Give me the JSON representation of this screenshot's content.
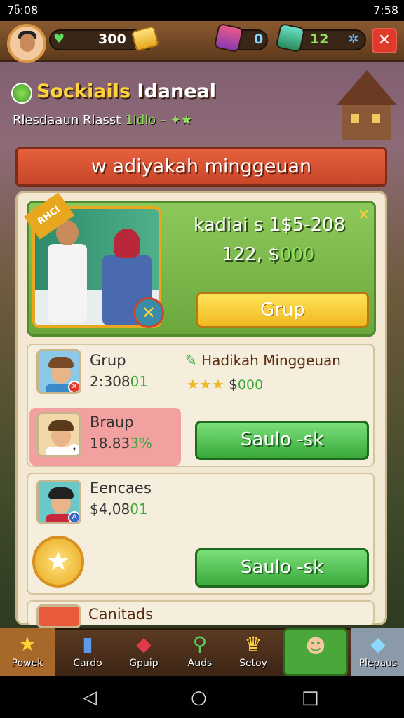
{
  "status_bar": {
    "time_left": "7ნ:08",
    "time_right": "7:58"
  },
  "top_bar": {
    "coins": "300",
    "gem_a": "0",
    "gem_b": "12",
    "close_label": "✕"
  },
  "header": {
    "title_yellow": "Sockiails",
    "title_white": "Idaneal",
    "subtitle": "Rlesdaaun Rlasst",
    "subtitle_green": "1Idlo",
    "subtitle_tail": "– ✦★"
  },
  "banner": {
    "label": "w adiyakah minggeuan"
  },
  "feature": {
    "corner_tag": "RHCI",
    "line1": "kadiai s 1$5-208",
    "line2_prefix": "122, $",
    "line2_green": "000",
    "button_label": "Grup",
    "close_label": "✕"
  },
  "rows": [
    {
      "name": "Grup",
      "value_prefix": "2:308",
      "value_green": "01"
    },
    {
      "name": "Braup",
      "value_prefix": "18.83",
      "value_green": "3%"
    },
    {
      "name": "Eencaes",
      "value_prefix": "$4,08",
      "value_green": "01"
    },
    {
      "name": "Canitads"
    }
  ],
  "reward": {
    "title": "Hadikah Minggeuan",
    "stars": "★★★",
    "amount_prefix": "$",
    "amount_green": "000"
  },
  "action_buttons": [
    {
      "label": "Saulo -sk"
    },
    {
      "label": "Saulo -sk"
    }
  ],
  "bottom_nav": [
    {
      "label": "Powek",
      "icon": "star-icon"
    },
    {
      "label": "Cardo",
      "icon": "card-icon"
    },
    {
      "label": "Gpuip",
      "icon": "ribbon-icon"
    },
    {
      "label": "Auds",
      "icon": "magnifier-icon"
    },
    {
      "label": "Setoy",
      "icon": "crown-icon"
    },
    {
      "label": "",
      "icon": "avatar-icon"
    },
    {
      "label": "Plepaus",
      "icon": "gem-icon"
    }
  ],
  "colors": {
    "accent_yellow": "#ffd33a",
    "accent_green": "#3aa83a",
    "banner_red": "#c8462a",
    "panel": "#f3e9d2"
  }
}
